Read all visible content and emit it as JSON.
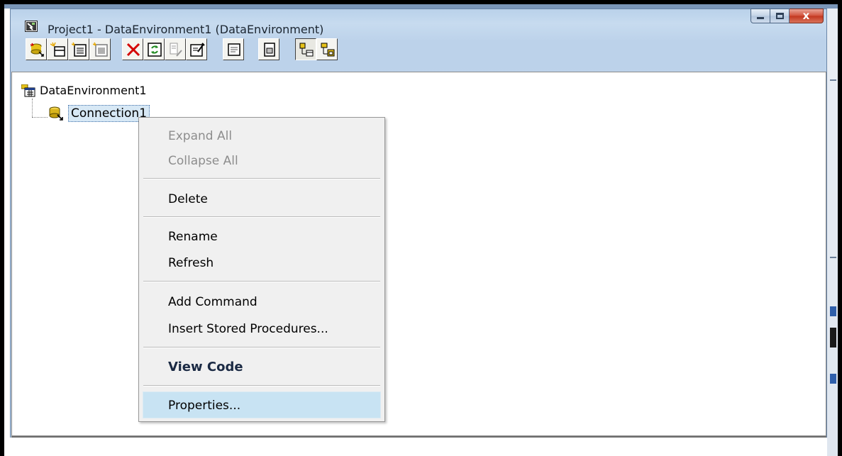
{
  "window": {
    "title": "Project1 - DataEnvironment1 (DataEnvironment)",
    "close_glyph": "x"
  },
  "toolbar": {
    "buttons": [
      {
        "icon": "add-connection-icon"
      },
      {
        "icon": "add-command-icon"
      },
      {
        "icon": "insert-stored-procedures-icon"
      },
      {
        "icon": "add-child-command-icon"
      },
      {
        "icon": "delete-icon"
      },
      {
        "icon": "refresh-icon"
      },
      {
        "icon": "design-icon"
      },
      {
        "icon": "properties-icon"
      },
      {
        "icon": "view-code-icon"
      },
      {
        "icon": "object-view-icon"
      },
      {
        "icon": "arrange-by-objects-icon"
      },
      {
        "icon": "arrange-by-connections-icon"
      }
    ]
  },
  "tree": {
    "root_label": "DataEnvironment1",
    "child_label": "Connection1"
  },
  "context_menu": {
    "items": [
      {
        "label": "Expand All",
        "enabled": false
      },
      {
        "label": "Collapse All",
        "enabled": false
      },
      {
        "label": "Delete",
        "enabled": true
      },
      {
        "label": "Rename",
        "enabled": true
      },
      {
        "label": "Refresh",
        "enabled": true
      },
      {
        "label": "Add Command",
        "enabled": true
      },
      {
        "label": "Insert Stored Procedures...",
        "enabled": true
      },
      {
        "label": "View Code",
        "enabled": true,
        "bold": true
      },
      {
        "label": "Properties...",
        "enabled": true,
        "highlighted": true
      }
    ]
  },
  "colors": {
    "highlight": "#c8e3f3",
    "selection": "#d7e8f5",
    "delete_red": "#d40000"
  }
}
